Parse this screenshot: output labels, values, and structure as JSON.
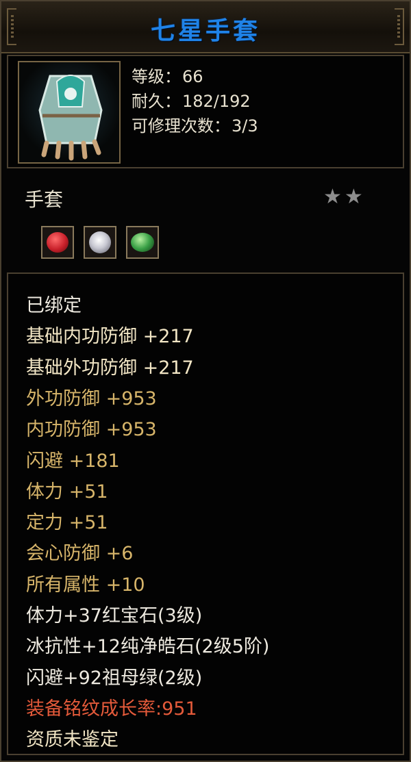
{
  "title": "七星手套",
  "item": {
    "level_label": "等级：",
    "level_value": "66",
    "durability_label": "耐久：",
    "durability_value": "182/192",
    "repair_label": "可修理次数：",
    "repair_value": "3/3",
    "type": "手套",
    "stars": "★★",
    "icon": "gauntlet-icon"
  },
  "gems": [
    {
      "name": "ruby-gem-icon",
      "color": "#c8202a"
    },
    {
      "name": "diamond-gem-icon",
      "color": "#d8d8e0"
    },
    {
      "name": "emerald-gem-icon",
      "color": "#3aa046"
    }
  ],
  "attributes": [
    {
      "text": "已绑定",
      "color": "white"
    },
    {
      "text": "基础内功防御 +217",
      "color": "cream"
    },
    {
      "text": "基础外功防御 +217",
      "color": "cream"
    },
    {
      "text": "外功防御 +953",
      "color": "gold"
    },
    {
      "text": "内功防御 +953",
      "color": "gold"
    },
    {
      "text": "闪避 +181",
      "color": "gold"
    },
    {
      "text": "体力 +51",
      "color": "gold"
    },
    {
      "text": "定力 +51",
      "color": "gold"
    },
    {
      "text": "会心防御 +6",
      "color": "gold"
    },
    {
      "text": "所有属性 +10",
      "color": "gold"
    },
    {
      "text": "体力+37红宝石(3级)",
      "color": "white"
    },
    {
      "text": "冰抗性+12纯净皓石(2级5阶)",
      "color": "white"
    },
    {
      "text": "闪避+92祖母绿(2级)",
      "color": "white"
    },
    {
      "text": "装备铭纹成长率:951",
      "color": "red"
    },
    {
      "text": "资质未鉴定",
      "color": "cream"
    }
  ],
  "colors": {
    "title": "#1f83e8",
    "gold": "#d7b56a",
    "red": "#e45a3a",
    "border": "#4a4030"
  }
}
